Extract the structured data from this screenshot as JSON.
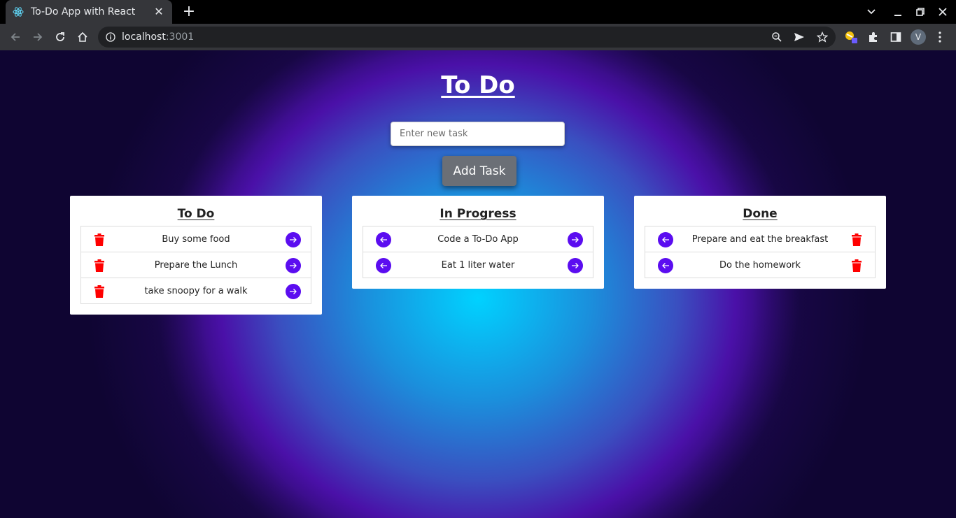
{
  "browser": {
    "tab_title": "To-Do App with React",
    "url_host": "localhost",
    "url_port": ":3001",
    "profile_initial": "V"
  },
  "app": {
    "title": "To Do",
    "input_placeholder": "Enter new task",
    "add_button_label": "Add Task",
    "accent_color": "#5b0df0",
    "delete_color": "#ff0000"
  },
  "columns": [
    {
      "title": "To Do",
      "tasks": [
        "Buy some food",
        "Prepare the Lunch",
        "take snoopy for a walk"
      ]
    },
    {
      "title": "In Progress",
      "tasks": [
        "Code a To-Do App",
        "Eat 1 liter water"
      ]
    },
    {
      "title": "Done",
      "tasks": [
        "Prepare and eat the breakfast",
        "Do the homework"
      ]
    }
  ]
}
